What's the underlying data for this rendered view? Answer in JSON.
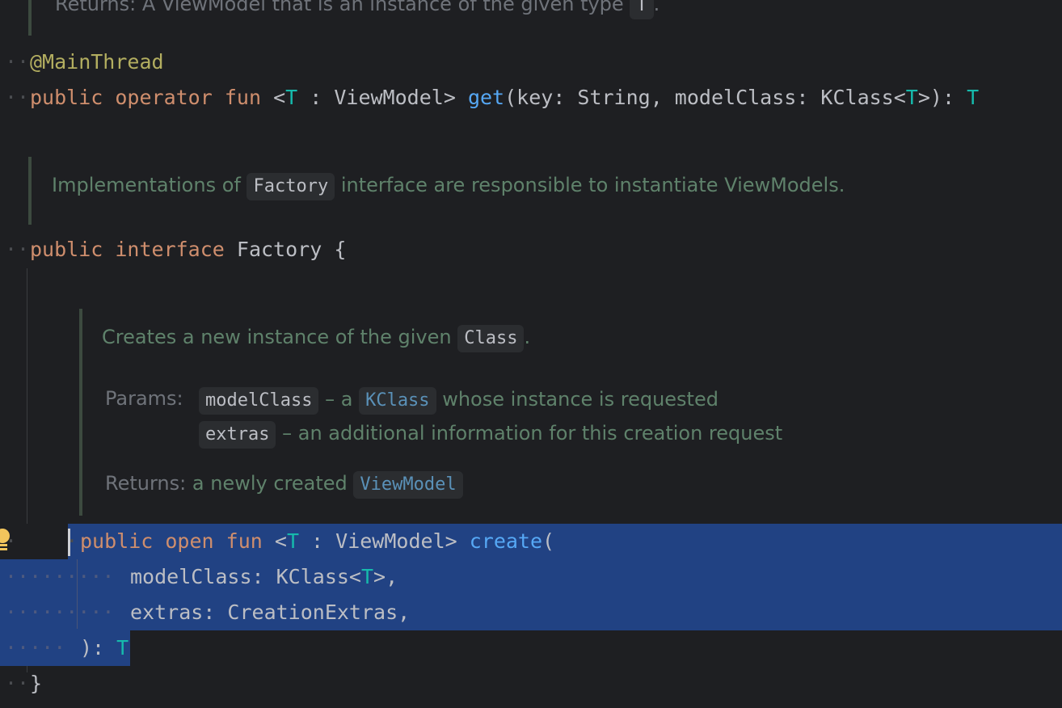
{
  "doc_top": {
    "returns_label": "Returns:",
    "returns_text": "A ViewModel that is an instance of the given type",
    "type_chip": "T",
    "period": "."
  },
  "annotation": "@MainThread",
  "get_signature": {
    "public": "public",
    "operator": "operator",
    "fun": "fun",
    "lt": "<",
    "T": "T",
    "bound": " : ViewModel>",
    "name": "get",
    "params_a": "(key: String, modelClass: KClass<",
    "params_T": "T",
    "params_b": ">): ",
    "ret": "T"
  },
  "factory_doc": {
    "before": "Implementations of",
    "chip": "Factory",
    "after": "interface are responsible to instantiate ViewModels."
  },
  "interface_decl": {
    "public": "public",
    "interface": "interface",
    "name": "Factory",
    "brace": "{"
  },
  "create_doc": {
    "summary_before": "Creates a new instance of the given",
    "summary_chip": "Class",
    "summary_after": ".",
    "params_label": "Params:",
    "param1_name": "modelClass",
    "param1_mid": "– a",
    "param1_link": "KClass",
    "param1_after": "whose instance is requested",
    "param2_name": "extras",
    "param2_after": "– an additional information for this creation request",
    "returns_label": "Returns:",
    "returns_text": "a newly created",
    "returns_link": "ViewModel"
  },
  "create_signature": {
    "public": "public",
    "open": "open",
    "fun": "fun",
    "lt": "<",
    "T": "T",
    "bound": " : ViewModel> ",
    "name": "create",
    "paren": "(",
    "p1_a": "modelClass: KClass<",
    "p1_T": "T",
    "p1_b": ">,",
    "p2": "extras: CreationExtras,",
    "close": "): ",
    "ret": "T"
  },
  "closing_brace": "}",
  "colors": {
    "background": "#1e1f22",
    "selection": "#214283",
    "keyword": "#cf8e6d",
    "function": "#56a8f5",
    "type_param": "#16baac",
    "annotation": "#b3ae60",
    "doc_text": "#5f826b"
  },
  "icons": {
    "intention": "lightbulb-icon"
  }
}
